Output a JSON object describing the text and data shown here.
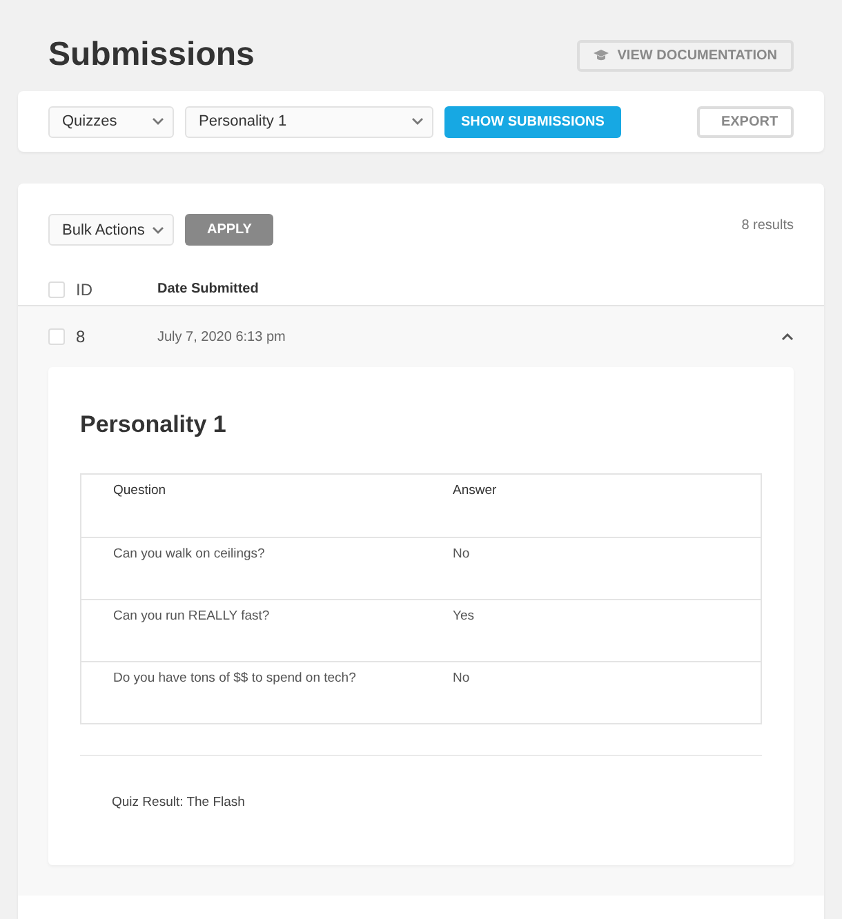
{
  "page_title": "Submissions",
  "doc_button": "VIEW DOCUMENTATION",
  "filters": {
    "type_select": "Quizzes",
    "quiz_select": "Personality 1",
    "show_button": "SHOW SUBMISSIONS",
    "export_button": "EXPORT"
  },
  "bulk": {
    "select": "Bulk Actions",
    "apply": "APPLY",
    "results": "8 results"
  },
  "table": {
    "columns": [
      "ID",
      "Date Submitted"
    ],
    "header_checked": false,
    "rows": [
      {
        "id": "8",
        "date": "July 7, 2020 6:13 pm",
        "checked": false,
        "expanded": true,
        "detail": {
          "title": "Personality 1",
          "columns": [
            "Question",
            "Answer"
          ],
          "answers": [
            {
              "question": "Can you walk on ceilings?",
              "answer": "No"
            },
            {
              "question": "Can you run REALLY fast?",
              "answer": "Yes"
            },
            {
              "question": "Do you have tons of $$ to spend on tech?",
              "answer": "No"
            }
          ],
          "result": "Quiz Result: The Flash"
        }
      }
    ]
  }
}
